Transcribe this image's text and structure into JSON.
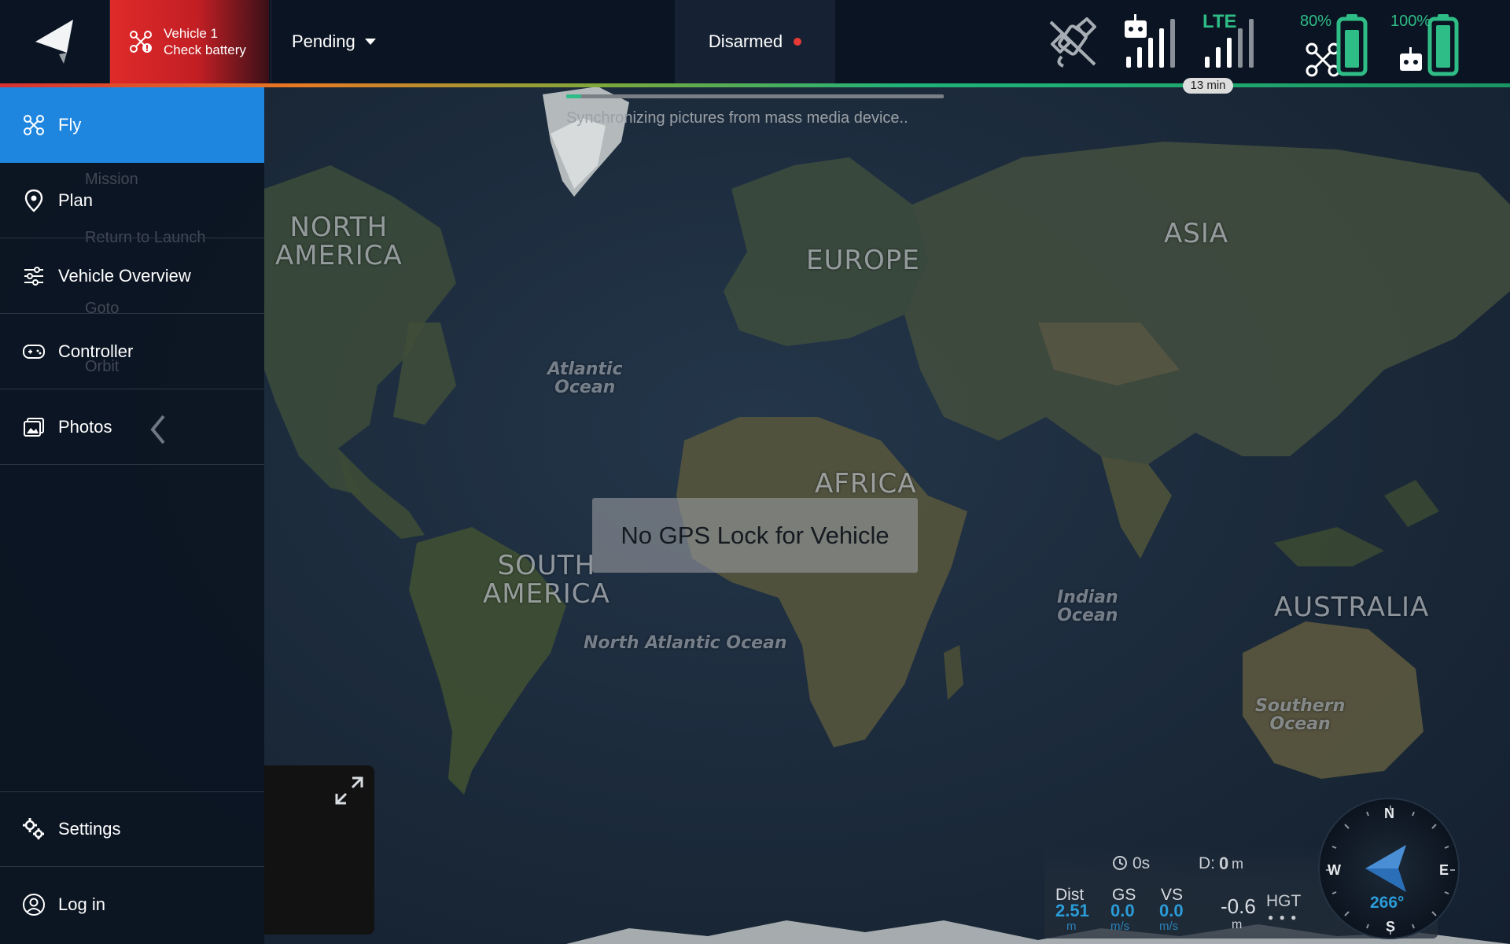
{
  "vehicle_alert": {
    "line1": "Vehicle 1",
    "line2": "Check battery"
  },
  "pending": {
    "label": "Pending"
  },
  "armed_state": {
    "label": "Disarmed",
    "indicator_color": "#e53935"
  },
  "status": {
    "lte_label": "LTE",
    "drone_battery": "80%",
    "controller_battery": "100%",
    "flight_time_remaining": "13 min",
    "accent_color": "#2fbd87"
  },
  "sync": {
    "label": "Synchronizing pictures from mass media device..",
    "progress": 0.04
  },
  "nav": {
    "fly": "Fly",
    "plan": "Plan",
    "vehicle_overview": "Vehicle Overview",
    "controller": "Controller",
    "photos": "Photos",
    "settings": "Settings",
    "login": "Log in"
  },
  "ghost_menu": {
    "mission": "Mission",
    "return_to_launch": "Return to Launch",
    "goto": "Goto",
    "orbit": "Orbit"
  },
  "map_labels": {
    "north_america": "NORTH\nAMERICA",
    "europe": "EUROPE",
    "asia": "ASIA",
    "africa": "AFRICA",
    "south_america": "SOUTH\nAMERICA",
    "australia": "AUSTRALIA",
    "atlantic": "Atlantic\nOcean",
    "indian": "Indian\nOcean",
    "north_atlantic": "North Atlantic Ocean",
    "southern": "Southern\nOcean"
  },
  "gps_message": "No GPS Lock for Vehicle",
  "telemetry": {
    "time": "0s",
    "d_label": "D:",
    "d_value": "0",
    "d_unit": "m",
    "dist_label": "Dist",
    "dist_value": "2.51",
    "dist_unit": "m",
    "gs_label": "GS",
    "gs_value": "0.0",
    "gs_unit": "m/s",
    "vs_label": "VS",
    "vs_value": "0.0",
    "vs_unit": "m/s",
    "hgt_value": "-0.6",
    "hgt_unit": "m",
    "hgt_label": "HGT"
  },
  "compass": {
    "n": "N",
    "s": "S",
    "e": "E",
    "w": "W",
    "heading": "266°"
  }
}
